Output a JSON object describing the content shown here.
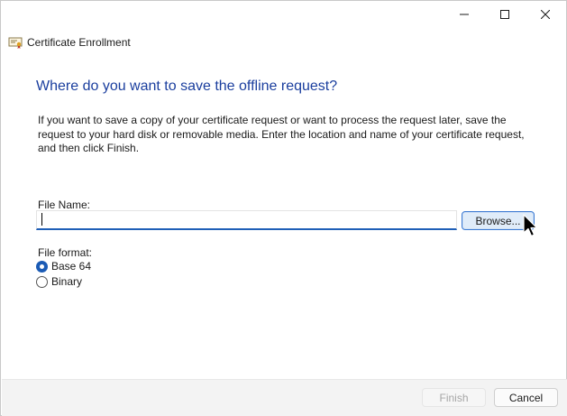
{
  "window": {
    "title": "Certificate Enrollment",
    "controls": {
      "minimize": "minimize-icon",
      "maximize": "maximize-icon",
      "close": "close-icon"
    }
  },
  "page": {
    "heading": "Where do you want to save the offline request?",
    "description": "If you want to save a copy of your certificate request or want to process the request later, save the request to your hard disk or removable media. Enter the location and name of your certificate request, and then click Finish."
  },
  "file": {
    "label": "File Name:",
    "value": "",
    "browse_label": "Browse..."
  },
  "format": {
    "label": "File format:",
    "options": [
      {
        "label": "Base 64",
        "selected": true
      },
      {
        "label": "Binary",
        "selected": false
      }
    ]
  },
  "footer": {
    "finish_label": "Finish",
    "finish_enabled": false,
    "cancel_label": "Cancel"
  },
  "colors": {
    "heading": "#1a3e9e",
    "accent": "#1b5bb5",
    "footer_bg": "#f3f3f3"
  }
}
